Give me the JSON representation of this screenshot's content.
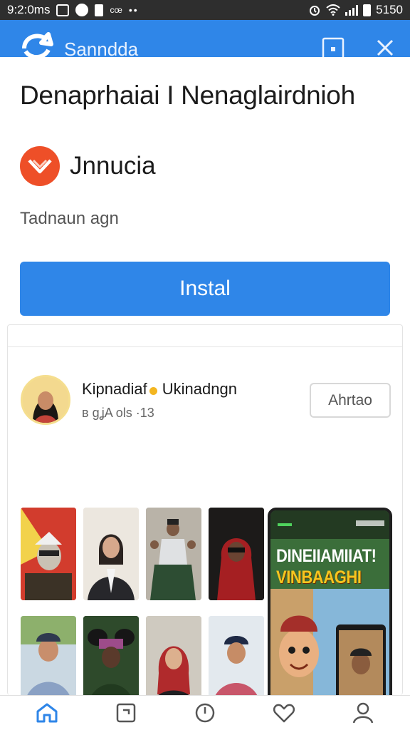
{
  "status_bar": {
    "time": "9:2:0ms",
    "clock_right": "5150",
    "dots": "••",
    "mini_label": "cœ"
  },
  "app_bar": {
    "app_name": "Sanndda"
  },
  "header": {
    "heading": "Denaprhaiai I Nenaglairdnioh"
  },
  "app": {
    "title": "Jnnucia",
    "subtitle": "Tadnaun agn",
    "install_label": "Instal",
    "accent_color": "#2f86e8",
    "icon_color": "#ee4f28"
  },
  "post": {
    "author_name": "Kipnadiaf",
    "author_name_tail": "Ukinadngn",
    "meta": "ʙ ɡʝA ols ·13",
    "follow_label": "Ahrtao",
    "phone_headline_1": "DINEIIAMIIAT!",
    "phone_headline_2": "VINBAAGHI"
  },
  "bottom_nav": {
    "items": [
      "home-icon",
      "square-icon",
      "clock-icon",
      "heart-icon",
      "person-icon"
    ]
  }
}
